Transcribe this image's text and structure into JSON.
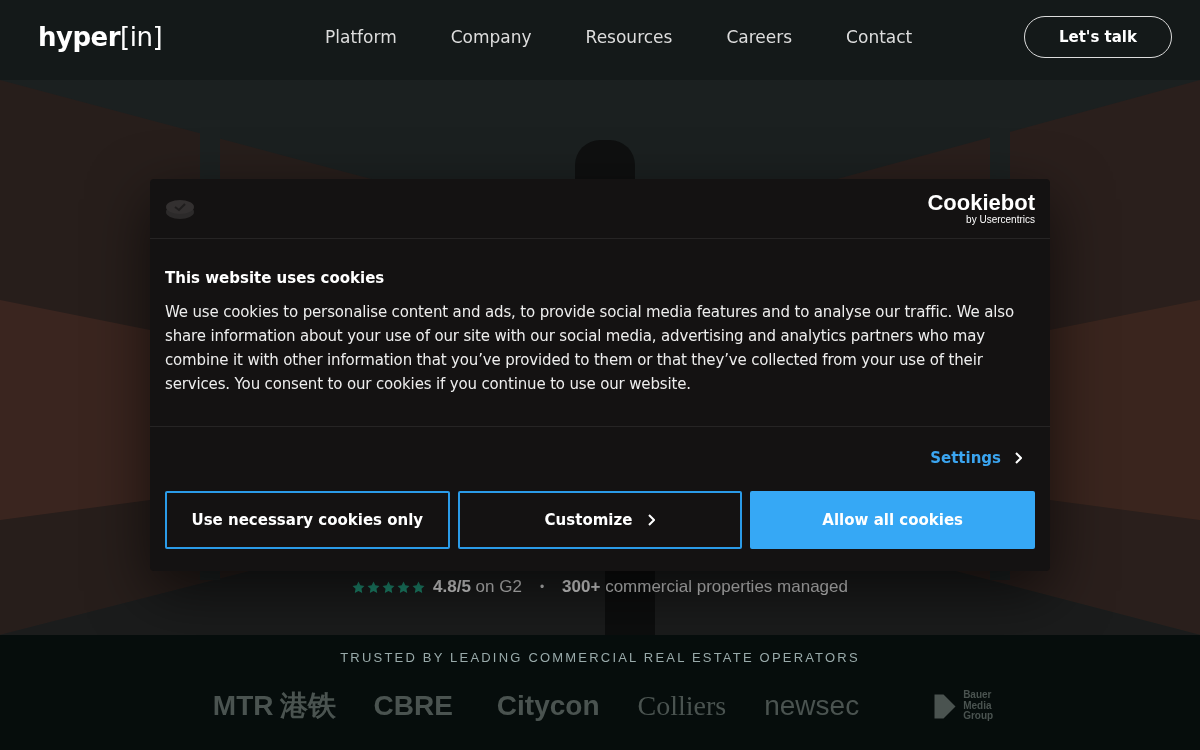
{
  "nav": {
    "logo_main": "hyper",
    "logo_bracket": "[in]",
    "links": [
      {
        "label": "Platform"
      },
      {
        "label": "Company"
      },
      {
        "label": "Resources"
      },
      {
        "label": "Careers"
      },
      {
        "label": "Contact"
      }
    ],
    "cta": "Let's talk"
  },
  "rating": {
    "stars": 5,
    "score": "4.8/5",
    "score_suffix": "on G2",
    "separator": "•",
    "count": "300+",
    "count_suffix": "commercial properties managed"
  },
  "trusted": {
    "heading": "TRUSTED BY LEADING COMMERCIAL REAL ESTATE OPERATORS",
    "logos": [
      {
        "kind": "mtr",
        "text": "MTR",
        "extra": "港铁"
      },
      {
        "kind": "cbre",
        "text": "CBRE"
      },
      {
        "kind": "citycon",
        "text": "Citycon"
      },
      {
        "kind": "colliers",
        "text": "Colliers"
      },
      {
        "kind": "newsec",
        "text": "newsec"
      },
      {
        "kind": "bauer",
        "text": "Bauer Media Group"
      }
    ]
  },
  "cookie_dialog": {
    "brand": "Cookiebot",
    "brand_sub": "by Usercentrics",
    "title": "This website uses cookies",
    "body": "We use cookies to personalise content and ads, to provide social media features and to analyse our traffic. We also share information about your use of our site with our social media, advertising and analytics partners who may combine it with other information that you’ve provided to them or that they’ve collected from your use of their services. You consent to our cookies if you continue to use our website.",
    "settings_link": "Settings",
    "buttons": [
      {
        "label": "Use necessary cookies only",
        "kind": "outline"
      },
      {
        "label": "Customize",
        "kind": "caret"
      },
      {
        "label": "Allow all cookies",
        "kind": "primary"
      }
    ]
  }
}
